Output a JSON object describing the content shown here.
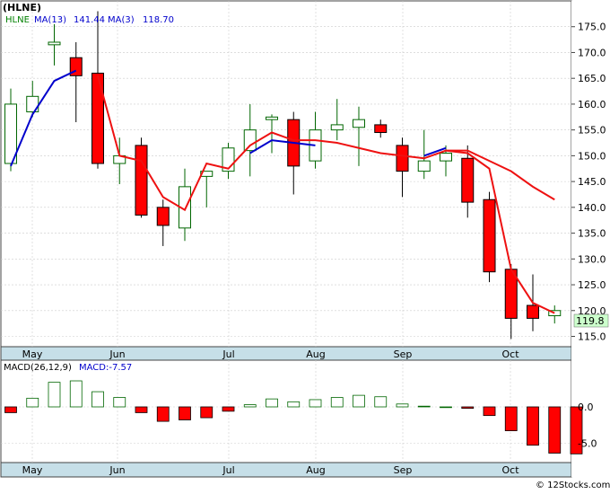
{
  "chart_data": [
    {
      "type": "candlestick",
      "title": "(HLNE)",
      "legend": [
        {
          "label": "HLNE",
          "color": "#008000"
        },
        {
          "label": "MA(13)",
          "value": "141.44",
          "color": "#ff0000"
        },
        {
          "label": "MA(3)",
          "value": "118.70",
          "color": "#0000cc"
        }
      ],
      "last_price_label": "119.8",
      "yticks": [
        "115.0",
        "120.0",
        "125.0",
        "130.0",
        "135.0",
        "140.0",
        "145.0",
        "150.0",
        "155.0",
        "160.0",
        "165.0",
        "170.0",
        "175.0"
      ],
      "ylim": [
        113,
        180
      ],
      "xtick_labels": [
        "May",
        "Jun",
        "Jul",
        "Aug",
        "Sep",
        "Oct"
      ],
      "x": [
        "Apr 26",
        "May 3",
        "May 10",
        "May 17",
        "May 24",
        "May 31",
        "Jun 7",
        "Jun 14",
        "Jun 21",
        "Jun 28",
        "Jul 5",
        "Jul 12",
        "Jul 19",
        "Jul 26",
        "Aug 2",
        "Aug 9",
        "Aug 16",
        "Aug 23",
        "Aug 30",
        "Sep 6",
        "Sep 13",
        "Sep 20",
        "Sep 27",
        "Oct 4",
        "Oct 11"
      ],
      "candles": [
        {
          "open": 148.5,
          "high": 163.0,
          "low": 147.0,
          "close": 160.0
        },
        {
          "open": 158.5,
          "high": 164.5,
          "low": 157.5,
          "close": 161.5
        },
        {
          "open": 171.5,
          "high": 175.5,
          "low": 167.5,
          "close": 172.0
        },
        {
          "open": 169.0,
          "high": 172.0,
          "low": 156.5,
          "close": 165.5
        },
        {
          "open": 166.0,
          "high": 178.0,
          "low": 147.5,
          "close": 148.5
        },
        {
          "open": 148.5,
          "high": 153.5,
          "low": 144.5,
          "close": 150.0
        },
        {
          "open": 152.0,
          "high": 153.5,
          "low": 138.0,
          "close": 138.5
        },
        {
          "open": 140.0,
          "high": 141.5,
          "low": 132.5,
          "close": 136.5
        },
        {
          "open": 136.0,
          "high": 147.5,
          "low": 133.5,
          "close": 144.0
        },
        {
          "open": 146.0,
          "high": 147.0,
          "low": 140.0,
          "close": 147.0
        },
        {
          "open": 147.0,
          "high": 152.5,
          "low": 145.5,
          "close": 151.5
        },
        {
          "open": 151.0,
          "high": 160.0,
          "low": 146.0,
          "close": 155.0
        },
        {
          "open": 157.0,
          "high": 158.0,
          "low": 150.5,
          "close": 157.5
        },
        {
          "open": 157.0,
          "high": 158.5,
          "low": 142.5,
          "close": 148.0
        },
        {
          "open": 149.0,
          "high": 158.5,
          "low": 147.5,
          "close": 155.0
        },
        {
          "open": 155.0,
          "high": 161.0,
          "low": 153.0,
          "close": 156.0
        },
        {
          "open": 155.5,
          "high": 159.5,
          "low": 148.0,
          "close": 157.0
        },
        {
          "open": 156.0,
          "high": 157.0,
          "low": 153.5,
          "close": 154.5
        },
        {
          "open": 152.0,
          "high": 153.5,
          "low": 142.0,
          "close": 147.0
        },
        {
          "open": 147.0,
          "high": 155.0,
          "low": 145.5,
          "close": 149.0
        },
        {
          "open": 149.0,
          "high": 152.0,
          "low": 146.0,
          "close": 150.5
        },
        {
          "open": 149.5,
          "high": 152.0,
          "low": 138.0,
          "close": 141.0
        },
        {
          "open": 141.5,
          "high": 143.0,
          "low": 125.5,
          "close": 127.5
        },
        {
          "open": 128.0,
          "high": 129.0,
          "low": 114.5,
          "close": 118.5
        },
        {
          "open": 121.0,
          "high": 127.0,
          "low": 116.0,
          "close": 118.5
        },
        {
          "open": 119.0,
          "high": 121.0,
          "low": 117.5,
          "close": 120.0
        }
      ],
      "series": [
        {
          "name": "MA(3)",
          "color": "#0000cc",
          "values": [
            148.0,
            158.0,
            164.5,
            166.5,
            null,
            150.0,
            null,
            null,
            null,
            144.0,
            null,
            150.5,
            153.0,
            152.5,
            152.0,
            null,
            155.5,
            null,
            null,
            150.0,
            151.5,
            null,
            null,
            null,
            null,
            null
          ]
        },
        {
          "name": "MA(13)",
          "color": "#ee1111",
          "values": [
            null,
            null,
            null,
            null,
            165.5,
            150.0,
            149.0,
            142.0,
            139.5,
            148.5,
            147.5,
            152.0,
            154.5,
            153.0,
            153.0,
            152.5,
            151.5,
            150.5,
            150.0,
            149.5,
            151.0,
            150.5,
            147.5,
            128.0,
            121.5,
            119.5
          ]
        },
        {
          "name": "MA(13) tail",
          "color": "#ee1111",
          "values": [
            null,
            null,
            null,
            null,
            null,
            null,
            null,
            null,
            null,
            null,
            null,
            null,
            null,
            null,
            null,
            null,
            null,
            null,
            null,
            null,
            151.0,
            151.0,
            149.0,
            147.0,
            144.0,
            141.5
          ]
        }
      ]
    },
    {
      "type": "bar",
      "title": "MACD(26,12,9)",
      "legend": [
        {
          "label": "MACD(26,12,9)",
          "color": "#000000"
        },
        {
          "label": "MACD:-7.57",
          "color": "#0000cc"
        }
      ],
      "yticks": [
        "0.0",
        "-5.0"
      ],
      "ylim": [
        -8,
        4
      ],
      "xtick_labels": [
        "May",
        "Jun",
        "Jul",
        "Aug",
        "Sep",
        "Oct"
      ],
      "values": [
        -0.8,
        1.2,
        3.4,
        3.6,
        2.1,
        1.3,
        -0.8,
        -2.0,
        -1.8,
        -1.5,
        -0.6,
        0.3,
        1.1,
        0.7,
        1.0,
        1.3,
        1.6,
        1.4,
        0.4,
        0.1,
        0.0,
        -0.2,
        -1.2,
        -3.3,
        -5.3,
        -6.4,
        -6.5
      ]
    }
  ],
  "footer": {
    "copyright": "© 12Stocks.com"
  },
  "colors": {
    "axis_bg": "#c6dfe8",
    "up": "#006600",
    "down": "#ff0000",
    "grid": "#cccccc"
  }
}
